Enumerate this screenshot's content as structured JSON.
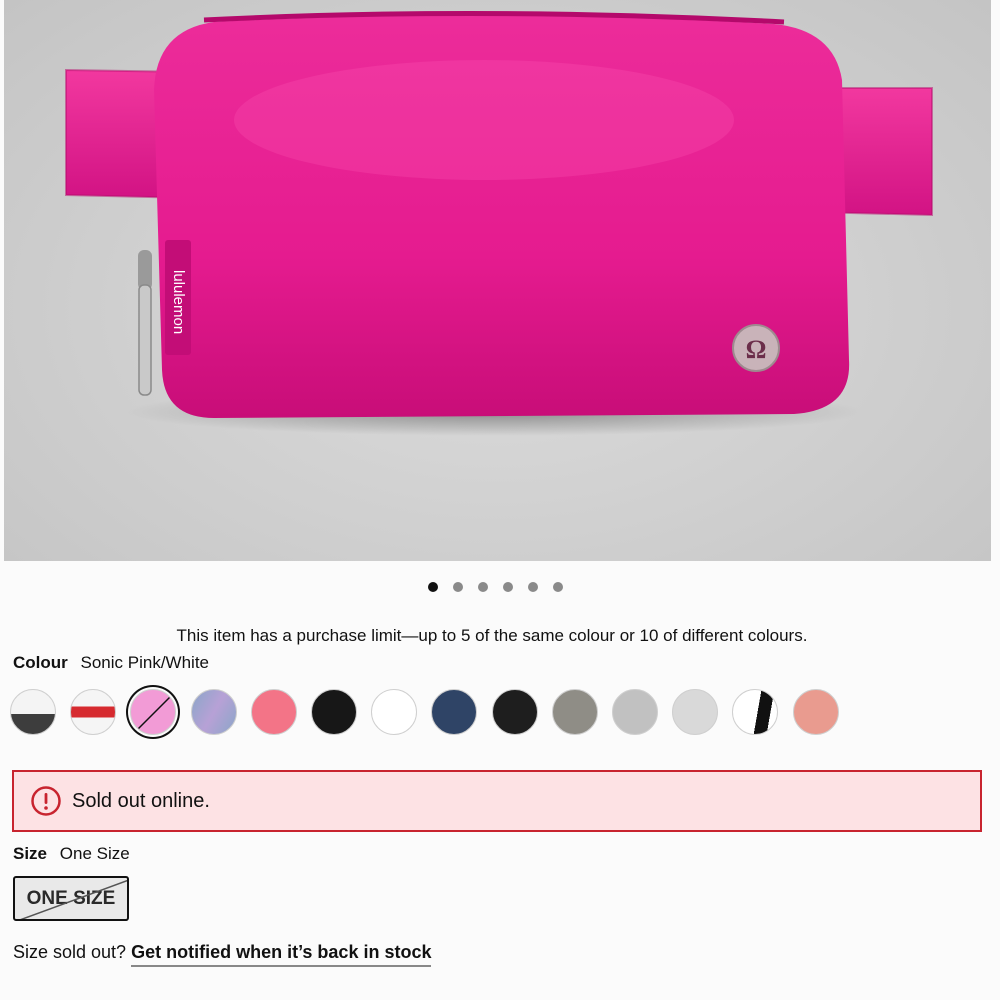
{
  "product": {
    "image_alt": "Everywhere Belt Bag",
    "brand_text": "lululemon",
    "carousel": {
      "count": 6,
      "active": 0
    }
  },
  "purchase_limit_note": "This item has a purchase limit—up to 5 of the same colour or 10 of different colours.",
  "colour": {
    "label": "Colour",
    "selected_name": "Sonic Pink/White",
    "swatches": [
      {
        "name": "white-black",
        "colors": [
          "#f4f4f4",
          "#3d3d3d"
        ],
        "selected": false,
        "unavailable": false
      },
      {
        "name": "white-red-stripe",
        "colors": [
          "#f5f5f5",
          "#d62a2f"
        ],
        "selected": false,
        "unavailable": false
      },
      {
        "name": "sonic-pink",
        "colors": [
          "#f29bd6"
        ],
        "selected": true,
        "unavailable": true
      },
      {
        "name": "iridescent-blue",
        "colors": [
          "#8aa6c8",
          "#b7a1d6"
        ],
        "selected": false,
        "unavailable": false
      },
      {
        "name": "coral-pink",
        "colors": [
          "#f37487"
        ],
        "selected": false,
        "unavailable": false
      },
      {
        "name": "black",
        "colors": [
          "#171717"
        ],
        "selected": false,
        "unavailable": false
      },
      {
        "name": "white",
        "colors": [
          "#ffffff"
        ],
        "selected": false,
        "unavailable": false
      },
      {
        "name": "navy",
        "colors": [
          "#2f4466"
        ],
        "selected": false,
        "unavailable": false
      },
      {
        "name": "black-textured",
        "colors": [
          "#1e1e1e"
        ],
        "selected": false,
        "unavailable": false
      },
      {
        "name": "grey-sage",
        "colors": [
          "#8f8d86"
        ],
        "selected": false,
        "unavailable": false
      },
      {
        "name": "light-grey",
        "colors": [
          "#c1c1c1"
        ],
        "selected": false,
        "unavailable": false
      },
      {
        "name": "silver-sparkle",
        "colors": [
          "#d9d9d9"
        ],
        "selected": false,
        "unavailable": false
      },
      {
        "name": "white-black-split",
        "colors": [
          "#ffffff",
          "#111111"
        ],
        "selected": false,
        "unavailable": false
      },
      {
        "name": "pink-blush",
        "colors": [
          "#e99b8f"
        ],
        "selected": false,
        "unavailable": false
      }
    ]
  },
  "alert": {
    "icon": "exclamation-circle-icon",
    "text": "Sold out online.",
    "border_color": "#c8242f",
    "bg_color": "#fde2e4"
  },
  "size": {
    "label": "Size",
    "selected": "One Size",
    "option_label": "ONE SIZE",
    "option_sold_out": true
  },
  "notify": {
    "prefix": "Size sold out?",
    "link": "Get notified when it’s back in stock"
  }
}
